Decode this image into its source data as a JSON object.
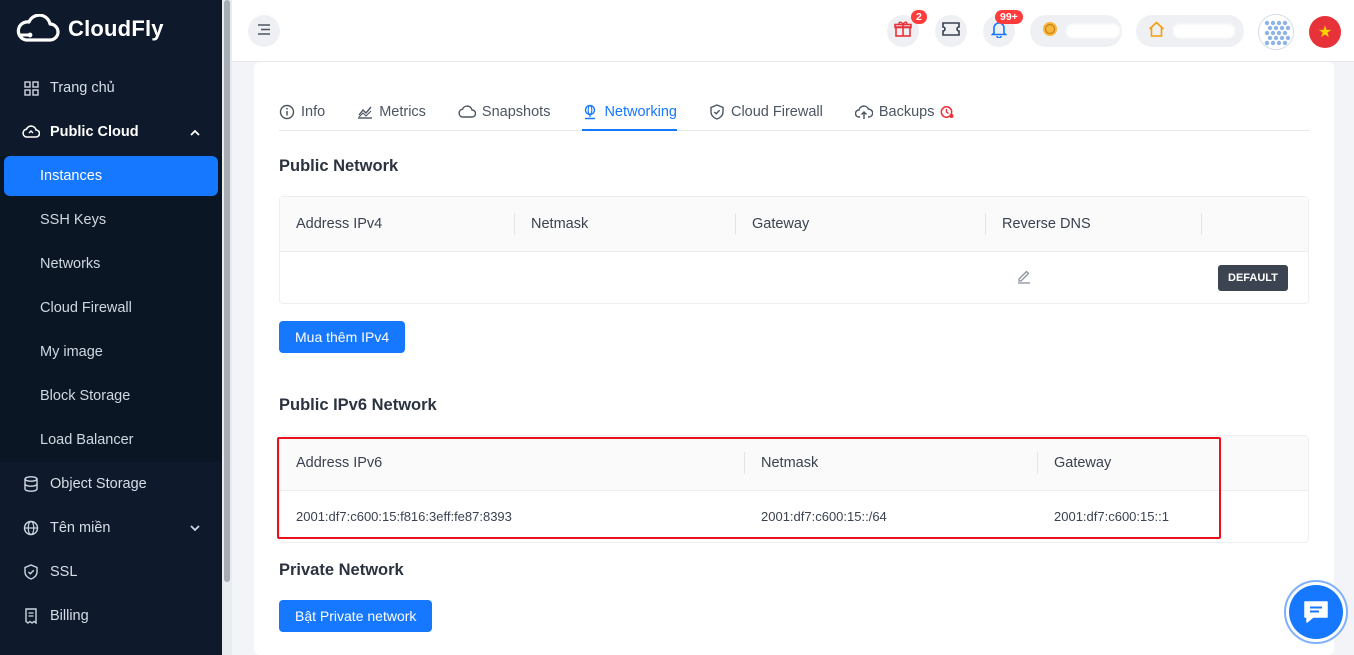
{
  "brand": {
    "name": "CloudFly"
  },
  "sidebar": {
    "items_top": [
      {
        "label": "Trang chủ",
        "icon": "dashboard-icon"
      },
      {
        "label": "Public Cloud",
        "icon": "cloud-icon",
        "expanded": true
      }
    ],
    "public_cloud_children": [
      {
        "label": "Instances",
        "active": true
      },
      {
        "label": "SSH Keys"
      },
      {
        "label": "Networks"
      },
      {
        "label": "Cloud Firewall"
      },
      {
        "label": "My image"
      },
      {
        "label": "Block Storage"
      },
      {
        "label": "Load Balancer"
      }
    ],
    "items_bottom": [
      {
        "label": "Object Storage",
        "icon": "database-icon"
      },
      {
        "label": "Tên miền",
        "icon": "globe-icon",
        "expandable": true
      },
      {
        "label": "SSL",
        "icon": "shield-icon"
      },
      {
        "label": "Billing",
        "icon": "invoice-icon"
      }
    ]
  },
  "header": {
    "gift_badge": "2",
    "notifications_badge": "99+"
  },
  "tabs": [
    {
      "label": "Info",
      "icon": "info-icon"
    },
    {
      "label": "Metrics",
      "icon": "chart-icon"
    },
    {
      "label": "Snapshots",
      "icon": "cloud-outline-icon"
    },
    {
      "label": "Networking",
      "icon": "network-icon",
      "active": true
    },
    {
      "label": "Cloud Firewall",
      "icon": "shield-check-icon"
    },
    {
      "label": "Backups",
      "icon": "cloud-upload-icon"
    }
  ],
  "public_network": {
    "title": "Public Network",
    "columns": [
      "Address IPv4",
      "Netmask",
      "Gateway",
      "Reverse DNS"
    ],
    "row": {
      "address": "",
      "netmask": "",
      "gateway": "",
      "tag": "DEFAULT"
    },
    "buy_button": "Mua thêm IPv4"
  },
  "ipv6_network": {
    "title": "Public IPv6 Network",
    "columns": [
      "Address IPv6",
      "Netmask",
      "Gateway"
    ],
    "row": {
      "address": "2001:df7:c600:15:f816:3eff:fe87:8393",
      "netmask": "2001:df7:c600:15::/64",
      "gateway": "2001:df7:c600:15::1"
    }
  },
  "private_network": {
    "title": "Private Network",
    "enable_button": "Bật Private network"
  },
  "colors": {
    "sidebar_bg": "#0e1a2b",
    "accent": "#1677ff",
    "highlight": "#e8111c",
    "badge": "#ff3b3b"
  }
}
